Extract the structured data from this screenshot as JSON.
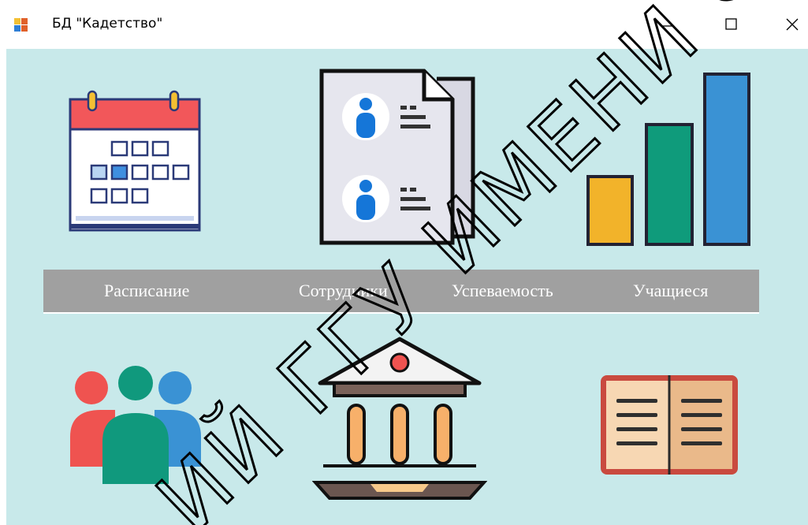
{
  "window": {
    "title": "БД \"Кадетство\"",
    "controls": [
      "minimize",
      "maximize",
      "close"
    ]
  },
  "menu": {
    "items": [
      {
        "label": "Расписание"
      },
      {
        "label": "Сотрудники"
      },
      {
        "label": "Успеваемость"
      },
      {
        "label": "Учащиеся"
      }
    ]
  },
  "icons": {
    "top": [
      "calendar-icon",
      "staff-documents-icon",
      "bar-chart-icon"
    ],
    "bottom": [
      "people-group-icon",
      "institution-building-icon",
      "open-book-icon"
    ]
  },
  "watermark": {
    "text": "ИЙ ГГУ ИМЕНИ Ф. СК"
  }
}
